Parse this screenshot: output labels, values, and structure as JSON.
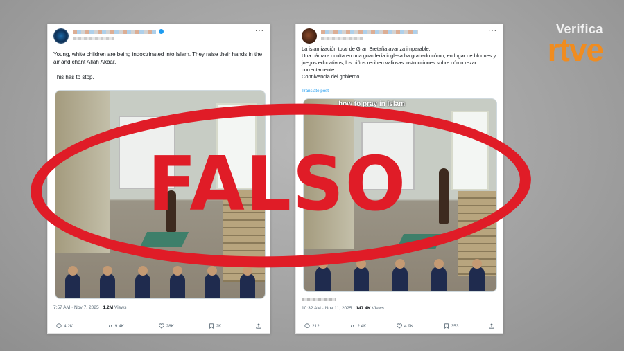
{
  "brand": {
    "small": "Verifica",
    "large": "rtve",
    "accent": "#f08c1f"
  },
  "stamp": {
    "label": "FALSO",
    "color": "#e01c27"
  },
  "tweet_1": {
    "text": "Young, white children are being indoctrinated into Islam. They raise their hands in the air and chant Allah Akbar.\n\nThis has to stop.",
    "timestamp": "7:57 AM · Nov 7, 2025 · ",
    "views_count": "1.2M",
    "views_label": " Views",
    "actions": {
      "replies": "4.2K",
      "reposts": "9.4K",
      "likes": "28K",
      "bookmarks": "2K"
    }
  },
  "tweet_2": {
    "text": "La islamización total de Gran Bretaña avanza imparable.\nUna cámara oculta en una guardería inglesa ha grabado cómo, en lugar de bloques y juegos educativos, los niños reciben valiosas instrucciones sobre cómo rezar correctamente.\nConnivencia del gobierno.",
    "translate": "Translate post",
    "video_caption": "how to pray in Islam",
    "timestamp": "10:32 AM · Nov 11, 2025 · ",
    "views_count": "147.4K",
    "views_label": " Views",
    "actions": {
      "replies": "212",
      "reposts": "2.4K",
      "likes": "4.9K",
      "bookmarks": "353"
    }
  },
  "icons": [
    "reply-icon",
    "repost-icon",
    "like-icon",
    "bookmark-icon",
    "share-icon",
    "more-icon",
    "verified-icon"
  ]
}
